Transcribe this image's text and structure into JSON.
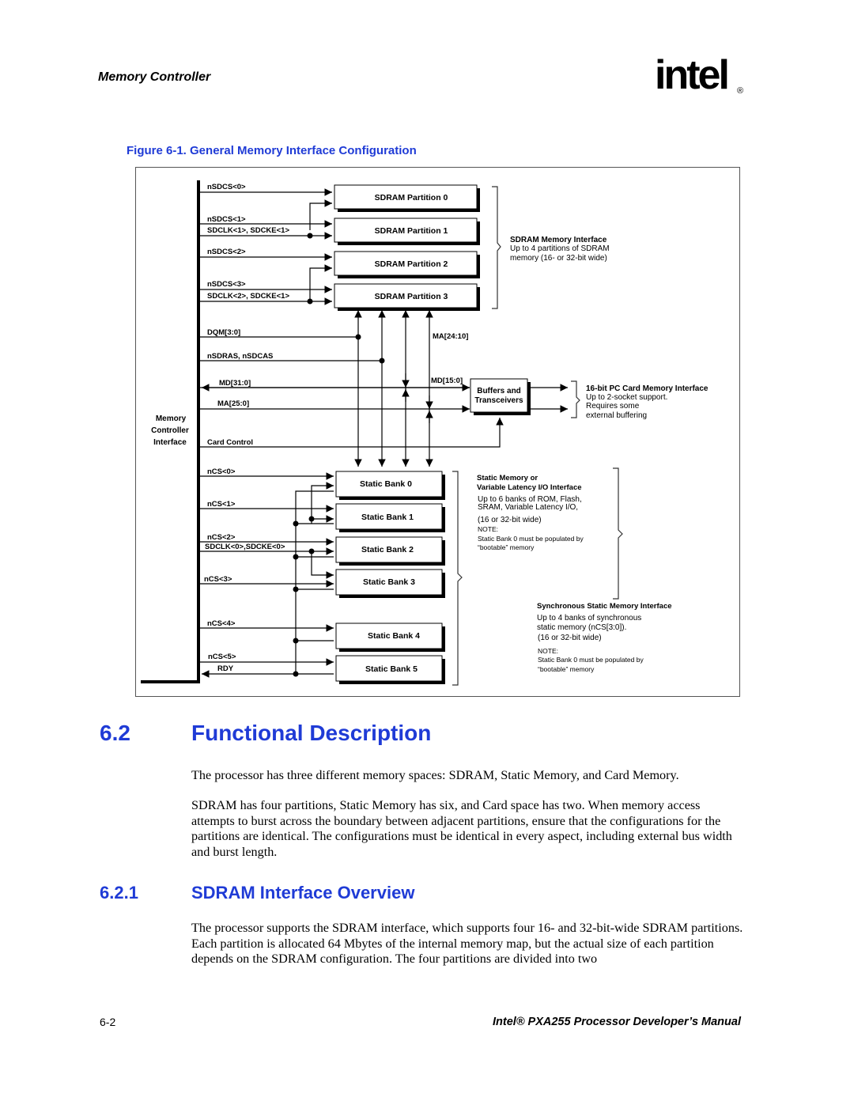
{
  "header": {
    "running_head": "Memory Controller",
    "logo_text": "intel",
    "logo_mark": "®"
  },
  "figure": {
    "title": "Figure 6-1. General Memory Interface Configuration",
    "controller_label": [
      "Memory",
      "Controller",
      "Interface"
    ],
    "sdram_signals": {
      "nsdcs0": "nSDCS<0>",
      "nsdcs1": "nSDCS<1>",
      "sdclk1": "SDCLK<1>, SDCKE<1>",
      "nsdcs2": "nSDCS<2>",
      "nsdcs3": "nSDCS<3>",
      "sdclk2": "SDCLK<2>, SDCKE<1>"
    },
    "sdram_partitions": [
      "SDRAM Partition 0",
      "SDRAM Partition 1",
      "SDRAM Partition 2",
      "SDRAM Partition 3"
    ],
    "sdram_note": {
      "title": "SDRAM Memory Interface",
      "lines": [
        "Up to 4 partitions of SDRAM",
        "memory (16- or 32-bit wide)"
      ]
    },
    "bus_signals": {
      "dqm": "DQM[3:0]",
      "ras_cas": "nSDRAS, nSDCAS",
      "md31": "MD[31:0]",
      "ma25": "MA[25:0]",
      "card_control": "Card Control",
      "ma24": "MA[24:10]",
      "md15": "MD[15:0]"
    },
    "buffers": [
      "Buffers and",
      "Transceivers"
    ],
    "pc_card_note": {
      "title": "16-bit PC Card Memory Interface",
      "lines": [
        "Up to 2-socket support.",
        "Requires some",
        "external buffering"
      ]
    },
    "static_signals": {
      "ncs0": "nCS<0>",
      "ncs1": "nCS<1>",
      "ncs2": "nCS<2>",
      "sdclk0": "SDCLK<0>,SDCKE<0>",
      "ncs3": "nCS<3>",
      "ncs4": "nCS<4>",
      "ncs5": "nCS<5>",
      "rdy": "RDY"
    },
    "static_banks": [
      "Static Bank 0",
      "Static Bank 1",
      "Static Bank 2",
      "Static Bank 3",
      "Static Bank 4",
      "Static Bank 5"
    ],
    "static_note": {
      "title1": "Static Memory or",
      "title2": "Variable Latency I/O Interface",
      "lines": [
        "Up to 6 banks of ROM, Flash,",
        "SRAM, Variable Latency I/O,",
        "(16 or 32-bit wide)"
      ],
      "note_label": "NOTE:",
      "note_lines": [
        "Static Bank 0 must be populated by",
        "“bootable” memory"
      ]
    },
    "sync_note": {
      "title": "Synchronous Static Memory Interface",
      "lines": [
        "Up to 4 banks of synchronous",
        "static memory (nCS[3:0]).",
        " (16 or 32-bit wide)"
      ],
      "note_label": "NOTE:",
      "note_lines": [
        "Static Bank 0 must be populated by",
        "“bootable” memory"
      ]
    }
  },
  "section_6_2": {
    "number": "6.2",
    "title": "Functional Description",
    "paragraphs": [
      "The processor has three different memory spaces: SDRAM, Static Memory, and Card Memory.",
      "SDRAM has four partitions, Static Memory has six, and Card space has two. When memory access attempts to burst across the boundary between adjacent partitions, ensure that the configurations for the partitions are identical. The configurations must be identical in every aspect, including external bus width and burst length."
    ]
  },
  "section_6_2_1": {
    "number": "6.2.1",
    "title": "SDRAM Interface Overview",
    "paragraphs": [
      "The processor supports the SDRAM interface, which supports four 16- and 32-bit-wide SDRAM partitions. Each partition is allocated 64 Mbytes of the internal memory map, but the actual size of each partition depends on the SDRAM configuration. The four partitions are divided into two"
    ]
  },
  "footer": {
    "page_number": "6-2",
    "manual_title": "Intel® PXA255 Processor Developer’s Manual"
  },
  "colors": {
    "heading_blue": "#1f3bd6"
  }
}
